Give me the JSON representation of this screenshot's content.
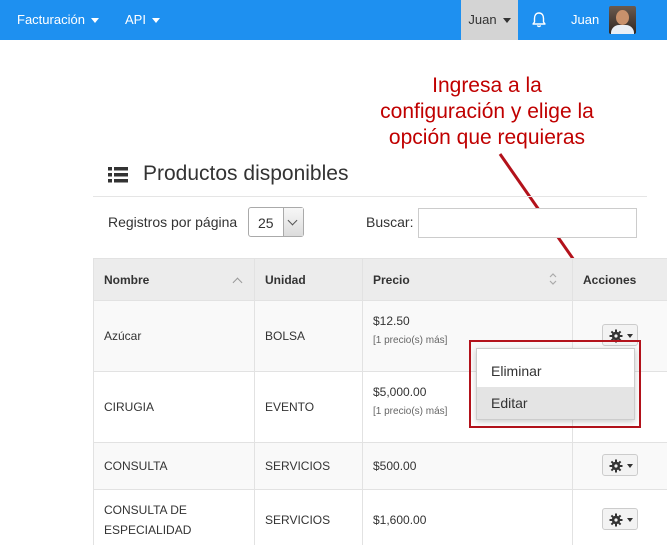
{
  "navbar": {
    "menu_facturacion": "Facturación",
    "menu_api": "API",
    "user_dropdown": "Juan",
    "user_name": "Juan",
    "bell_icon": "bell-icon",
    "background": "#1e90f0"
  },
  "annotation": {
    "line1": "Ingresa a la",
    "line2": "configuración y elige la",
    "line3": "opción que requieras",
    "color": "#c00000"
  },
  "panel": {
    "title": "Productos disponibles",
    "icon": "list-icon",
    "records_label": "Registros por página",
    "records_value": "25",
    "search_label": "Buscar:",
    "search_value": ""
  },
  "table": {
    "headers": [
      "Nombre",
      "Unidad",
      "Precio",
      "Acciones"
    ],
    "rows": [
      {
        "nombre": "Azúcar",
        "unidad": "BOLSA",
        "precio": "$12.50",
        "extra": "[1 precio(s) más]"
      },
      {
        "nombre": "CIRUGIA",
        "unidad": "EVENTO",
        "precio": "$5,000.00",
        "extra": "[1 precio(s) más]"
      },
      {
        "nombre": "CONSULTA",
        "unidad": "SERVICIOS",
        "precio": "$500.00",
        "extra": ""
      },
      {
        "nombre_line1": "CONSULTA DE",
        "nombre_line2": "ESPECIALIDAD",
        "unidad": "SERVICIOS",
        "precio": "$1,600.00",
        "extra": ""
      }
    ]
  },
  "dropdown": {
    "items": [
      "Eliminar",
      "Editar"
    ],
    "active_index": 1
  }
}
